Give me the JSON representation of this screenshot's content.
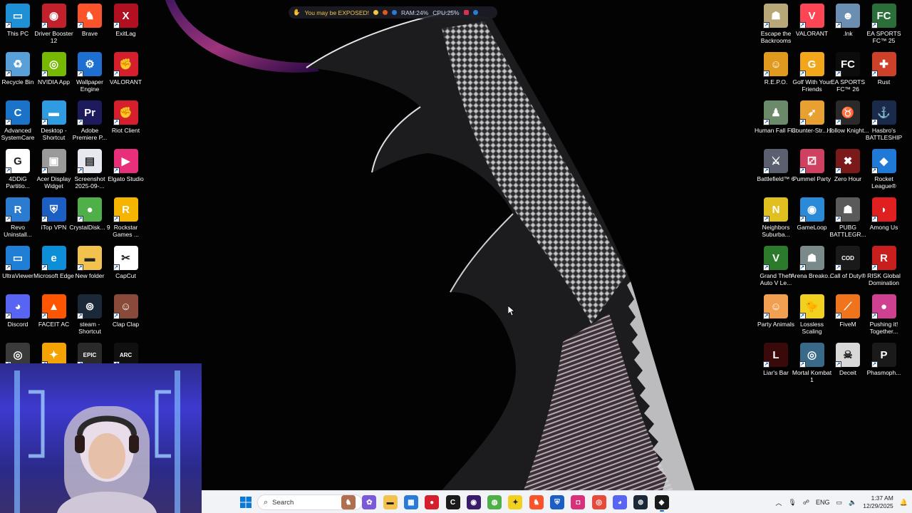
{
  "overlay": {
    "warning": "You may be EXPOSED!",
    "ram": "RAM:24%",
    "cpu": "CPU:25%"
  },
  "desktop_left": [
    {
      "label": "This PC",
      "icon": "pc-icon",
      "color": "#1e90d6",
      "glyph": "▭"
    },
    {
      "label": "Driver Booster 12",
      "icon": "driver-booster-icon",
      "color": "#c2202a",
      "glyph": "◉"
    },
    {
      "label": "Brave",
      "icon": "brave-icon",
      "color": "#fb542b",
      "glyph": "♞"
    },
    {
      "label": "ExitLag",
      "icon": "exitlag-icon",
      "color": "#b01020",
      "glyph": "X"
    },
    {
      "label": "Recycle Bin",
      "icon": "recycle-bin-icon",
      "color": "#5aa0d8",
      "glyph": "♻"
    },
    {
      "label": "NVIDIA App",
      "icon": "nvidia-icon",
      "color": "#76b900",
      "glyph": "◎"
    },
    {
      "label": "Wallpaper Engine",
      "icon": "wallpaper-engine-icon",
      "color": "#1d6fd1",
      "glyph": "⚙"
    },
    {
      "label": "VALORANT",
      "icon": "valorant-riot-icon",
      "color": "#d61f2c",
      "glyph": "✊"
    },
    {
      "label": "Advanced SystemCare",
      "icon": "systemcare-icon",
      "color": "#1a73c9",
      "glyph": "C"
    },
    {
      "label": "Desktop - Shortcut",
      "icon": "folder-icon",
      "color": "#2f9be0",
      "glyph": "▬"
    },
    {
      "label": "Adobe Premiere P...",
      "icon": "premiere-icon",
      "color": "#1d1a5e",
      "glyph": "Pr"
    },
    {
      "label": "Riot Client",
      "icon": "riot-client-icon",
      "color": "#d61f2c",
      "glyph": "✊"
    },
    {
      "label": "4DDiG Partitio...",
      "icon": "4ddig-icon",
      "color": "#ffffff",
      "glyph": "G"
    },
    {
      "label": "Acer Display Widget",
      "icon": "acer-widget-icon",
      "color": "#9a9a9a",
      "glyph": "▣"
    },
    {
      "label": "Screenshot 2025-09-...",
      "icon": "screenshot-file-icon",
      "color": "#e8e8f0",
      "glyph": "▤"
    },
    {
      "label": "Elgato Studio",
      "icon": "elgato-icon",
      "color": "#e8307a",
      "glyph": "▶"
    },
    {
      "label": "Revo Uninstall...",
      "icon": "revo-icon",
      "color": "#2b7bd1",
      "glyph": "R"
    },
    {
      "label": "iTop VPN",
      "icon": "itop-vpn-icon",
      "color": "#1b5fc4",
      "glyph": "⛨"
    },
    {
      "label": "CrystalDisk... 9",
      "icon": "crystaldisk-icon",
      "color": "#4fb04a",
      "glyph": "●"
    },
    {
      "label": "Rockstar Games ...",
      "icon": "rockstar-icon",
      "color": "#f4b400",
      "glyph": "R"
    },
    {
      "label": "UltraViewer",
      "icon": "ultraviewer-icon",
      "color": "#1f7fd6",
      "glyph": "▭"
    },
    {
      "label": "Microsoft Edge",
      "icon": "edge-icon",
      "color": "#0c8fd8",
      "glyph": "e"
    },
    {
      "label": "New folder",
      "icon": "new-folder-icon",
      "color": "#f2c14e",
      "glyph": "▬"
    },
    {
      "label": "CapCut",
      "icon": "capcut-icon",
      "color": "#ffffff",
      "glyph": "✂"
    },
    {
      "label": "Discord",
      "icon": "discord-icon",
      "color": "#5865f2",
      "glyph": "◕"
    },
    {
      "label": "FACEIT AC",
      "icon": "faceit-icon",
      "color": "#ff5500",
      "glyph": "▲"
    },
    {
      "label": "steam - Shortcut",
      "icon": "steam-icon",
      "color": "#1b2838",
      "glyph": "⊚"
    },
    {
      "label": "Clap Clap",
      "icon": "clap-clap-icon",
      "color": "#8a4a3a",
      "glyph": "☺"
    },
    {
      "label": "",
      "icon": "ubisoft-icon",
      "color": "#3a3a3a",
      "glyph": "◎"
    },
    {
      "label": "",
      "icon": "app-icon",
      "color": "#f4a300",
      "glyph": "✦"
    },
    {
      "label": "",
      "icon": "epic-games-icon",
      "color": "#2a2a2a",
      "glyph": "EPIC"
    },
    {
      "label": "",
      "icon": "arc-raiders-icon",
      "color": "#101010",
      "glyph": "ARC"
    }
  ],
  "desktop_right": [
    {
      "label": "Escape the Backrooms",
      "icon": "backrooms-icon",
      "color": "#b8a878",
      "glyph": "☗"
    },
    {
      "label": "VALORANT",
      "icon": "valorant-icon",
      "color": "#fd4556",
      "glyph": "V"
    },
    {
      "label": ".lnk",
      "icon": "lnk-icon",
      "color": "#6b8fb3",
      "glyph": "☻"
    },
    {
      "label": "EA SPORTS FC™ 25",
      "icon": "ea-fc25-icon",
      "color": "#2c6e3a",
      "glyph": "FC"
    },
    {
      "label": "R.E.P.O.",
      "icon": "repo-icon",
      "color": "#e09b1f",
      "glyph": "☺"
    },
    {
      "label": "Golf With Your Friends",
      "icon": "golf-icon",
      "color": "#f2a71b",
      "glyph": "G"
    },
    {
      "label": "EA SPORTS FC™ 26",
      "icon": "ea-fc26-icon",
      "color": "#0c0c0c",
      "glyph": "FC"
    },
    {
      "label": "Rust",
      "icon": "rust-icon",
      "color": "#cd412b",
      "glyph": "✚"
    },
    {
      "label": "Human Fall Flat",
      "icon": "human-fall-flat-icon",
      "color": "#6a8a6a",
      "glyph": "♟"
    },
    {
      "label": "Counter-Str... 2",
      "icon": "cs2-icon",
      "color": "#e8a030",
      "glyph": "➶"
    },
    {
      "label": "Hollow Knight...",
      "icon": "hollow-knight-icon",
      "color": "#2a2a2a",
      "glyph": "♉"
    },
    {
      "label": "Hasbro's BATTLESHIP",
      "icon": "battleship-icon",
      "color": "#1a2a4a",
      "glyph": "⚓"
    },
    {
      "label": "Battlefield™ 6",
      "icon": "battlefield-icon",
      "color": "#5a6070",
      "glyph": "⚔"
    },
    {
      "label": "Pummel Party",
      "icon": "pummel-party-icon",
      "color": "#d04060",
      "glyph": "⚂"
    },
    {
      "label": "Zero Hour",
      "icon": "zero-hour-icon",
      "color": "#7a1a1a",
      "glyph": "✖"
    },
    {
      "label": "Rocket League®",
      "icon": "rocket-league-icon",
      "color": "#1e7ad6",
      "glyph": "◆"
    },
    {
      "label": "Neighbors Suburba...",
      "icon": "neighbors-icon",
      "color": "#e0c020",
      "glyph": "N"
    },
    {
      "label": "GameLoop",
      "icon": "gameloop-icon",
      "color": "#2a8ad8",
      "glyph": "◉"
    },
    {
      "label": "PUBG BATTLEGR...",
      "icon": "pubg-icon",
      "color": "#5a5a5a",
      "glyph": "☗"
    },
    {
      "label": "Among Us",
      "icon": "among-us-icon",
      "color": "#e02020",
      "glyph": "◗"
    },
    {
      "label": "Grand Theft Auto V Le...",
      "icon": "gta5-icon",
      "color": "#2c7a2c",
      "glyph": "V"
    },
    {
      "label": "Arena Breako...",
      "icon": "arena-breakout-icon",
      "color": "#7a8a8a",
      "glyph": "☗"
    },
    {
      "label": "Call of Duty®",
      "icon": "call-of-duty-icon",
      "color": "#1a1a1a",
      "glyph": "COD"
    },
    {
      "label": "RISK Global Domination",
      "icon": "risk-icon",
      "color": "#c81e1e",
      "glyph": "R"
    },
    {
      "label": "Party Animals",
      "icon": "party-animals-icon",
      "color": "#f0a050",
      "glyph": "☺"
    },
    {
      "label": "Lossless Scaling",
      "icon": "lossless-scaling-icon",
      "color": "#f2d020",
      "glyph": "🐤"
    },
    {
      "label": "FiveM",
      "icon": "fivem-icon",
      "color": "#f0741c",
      "glyph": "⟋"
    },
    {
      "label": "Pushing it! Together...",
      "icon": "pushing-it-icon",
      "color": "#d04090",
      "glyph": "●"
    },
    {
      "label": "Liar's Bar",
      "icon": "liars-bar-icon",
      "color": "#3a0a0a",
      "glyph": "L"
    },
    {
      "label": "Mortal Kombat 1",
      "icon": "mortal-kombat-icon",
      "color": "#3a6a8a",
      "glyph": "◎"
    },
    {
      "label": "Deceit",
      "icon": "deceit-icon",
      "color": "#d8d8d8",
      "glyph": "☠"
    },
    {
      "label": "Phasmoph...",
      "icon": "phasmophobia-icon",
      "color": "#1a1a1a",
      "glyph": "P"
    }
  ],
  "taskbar": {
    "search_placeholder": "Search",
    "language": "ENG",
    "time": "1:37 AM",
    "date": "12/29/2025",
    "items": [
      {
        "name": "chess-widget-icon",
        "color": "#b07050",
        "glyph": "♞"
      },
      {
        "name": "copilot-icon",
        "color": "#7a5ad8",
        "glyph": "✿"
      },
      {
        "name": "file-explorer-icon",
        "color": "#f2c14e",
        "glyph": "▬"
      },
      {
        "name": "microsoft-store-icon",
        "color": "#2a7ad8",
        "glyph": "▦"
      },
      {
        "name": "riot-taskbar-icon",
        "color": "#d61f2c",
        "glyph": "●"
      },
      {
        "name": "capcut-taskbar-icon",
        "color": "#1a1a1a",
        "glyph": "C"
      },
      {
        "name": "obs-icon",
        "color": "#3a1a6a",
        "glyph": "◉"
      },
      {
        "name": "crystaldisk-taskbar-icon",
        "color": "#4fb04a",
        "glyph": "◍"
      },
      {
        "name": "lossless-taskbar-icon",
        "color": "#f2d020",
        "glyph": "✦"
      },
      {
        "name": "brave-taskbar-icon",
        "color": "#fb542b",
        "glyph": "♞"
      },
      {
        "name": "vpn-taskbar-icon",
        "color": "#1b5fc4",
        "glyph": "⛨"
      },
      {
        "name": "instagram-icon",
        "color": "#d8307a",
        "glyph": "◘"
      },
      {
        "name": "chrome-icon",
        "color": "#e84a3a",
        "glyph": "◎"
      },
      {
        "name": "discord-taskbar-icon",
        "color": "#5865f2",
        "glyph": "◕"
      },
      {
        "name": "steam-taskbar-icon",
        "color": "#1b2838",
        "glyph": "⊚"
      },
      {
        "name": "app-active-icon",
        "color": "#1a1a1a",
        "glyph": "◆"
      }
    ]
  }
}
